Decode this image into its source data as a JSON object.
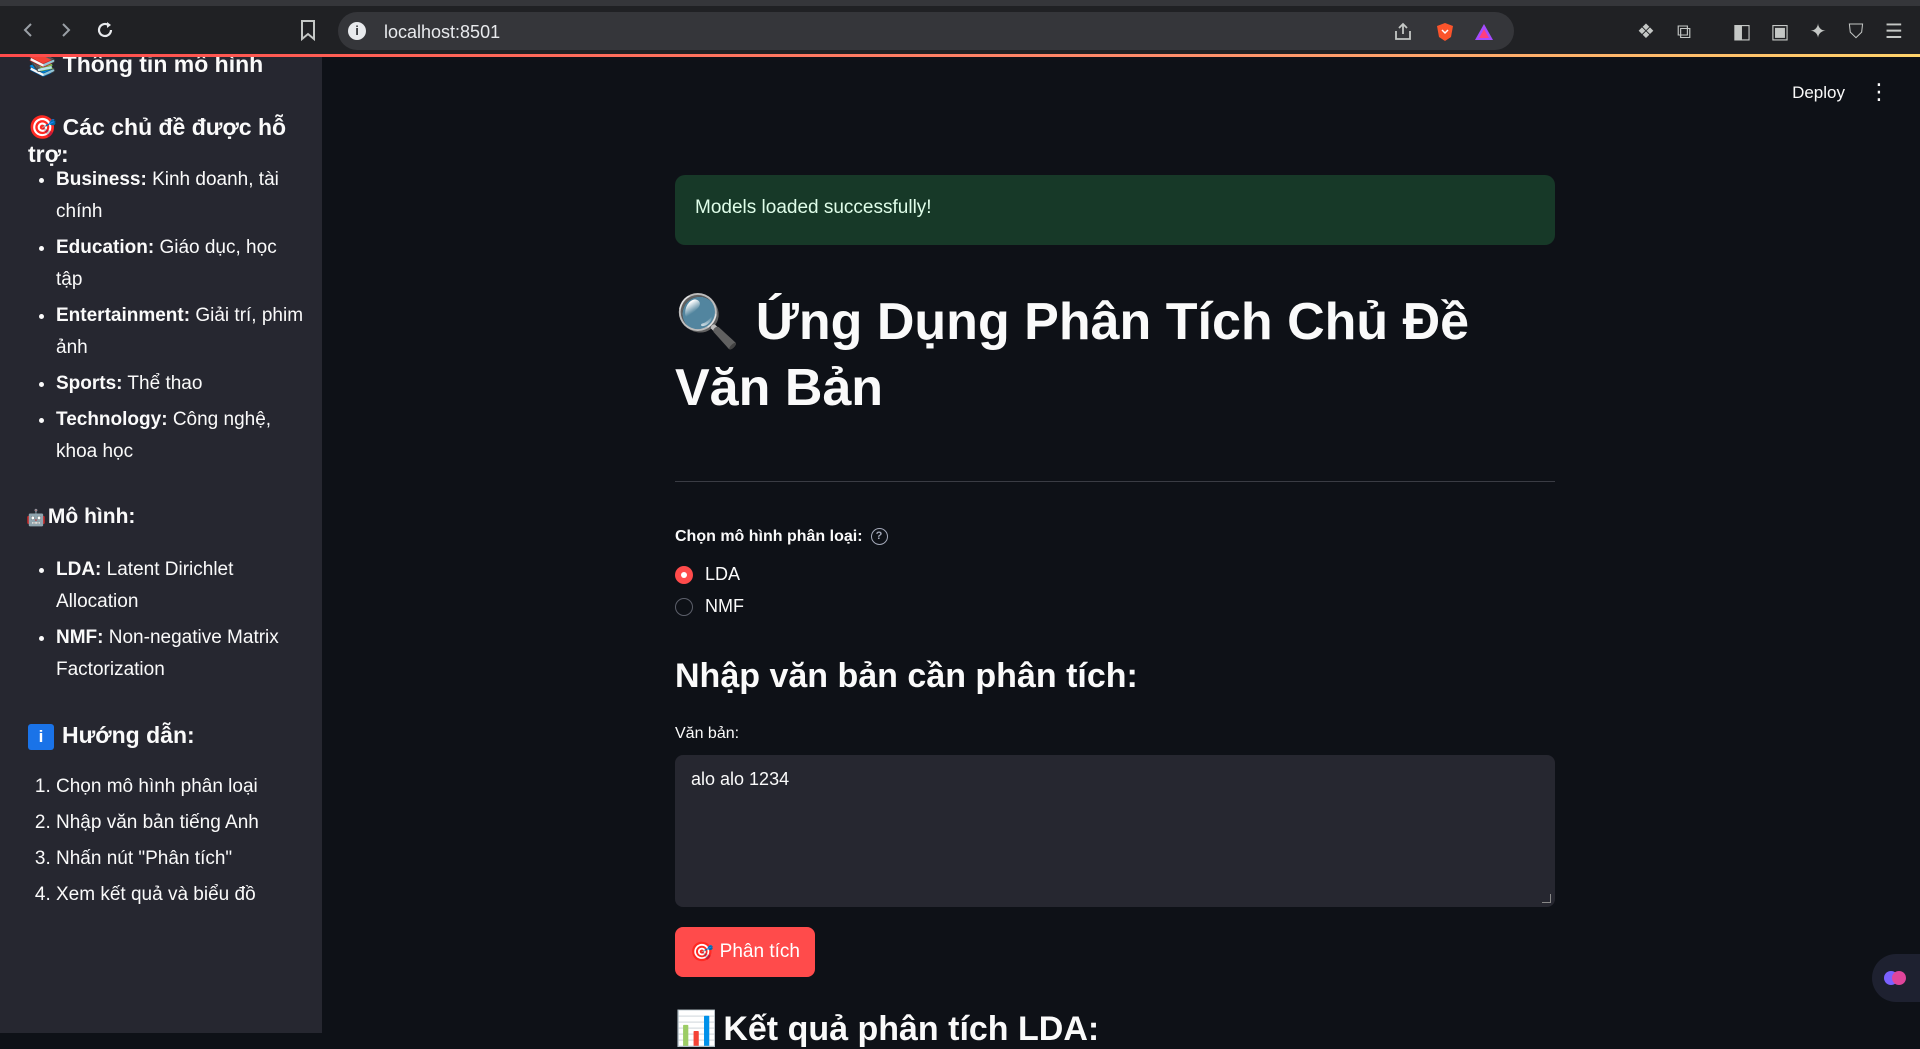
{
  "browser": {
    "url": "localhost:8501",
    "back_icon": "chevron-left-icon",
    "forward_icon": "chevron-right-icon",
    "reload_icon": "reload-icon"
  },
  "sidebar": {
    "model_info_heading": "Thông tin mô hình",
    "topics_heading": "Các chủ đề được hỗ trợ:",
    "topics": [
      {
        "name": "Business:",
        "desc": " Kinh doanh, tài chính"
      },
      {
        "name": "Education:",
        "desc": " Giáo dục, học tập"
      },
      {
        "name": "Entertainment:",
        "desc": " Giải trí, phim ảnh"
      },
      {
        "name": "Sports:",
        "desc": " Thể thao"
      },
      {
        "name": "Technology:",
        "desc": " Công nghệ, khoa học"
      }
    ],
    "models_heading": "Mô hình:",
    "models": [
      {
        "name": "LDA:",
        "desc": " Latent Dirichlet Allocation"
      },
      {
        "name": "NMF:",
        "desc": " Non-negative Matrix Factorization"
      }
    ],
    "guide_heading": "Hướng dẫn:",
    "guide_steps": [
      "Chọn mô hình phân loại",
      "Nhập văn bản tiếng Anh",
      "Nhấn nút \"Phân tích\"",
      "Xem kết quả và biểu đồ"
    ]
  },
  "header": {
    "deploy_label": "Deploy",
    "menu_icon": "kebab-menu-icon"
  },
  "main": {
    "success_message": "Models loaded successfully!",
    "title": "Ứng Dụng Phân Tích Chủ Đề Văn Bản",
    "model_select_label": "Chọn mô hình phân loại:",
    "model_options": [
      "LDA",
      "NMF"
    ],
    "model_selected": "LDA",
    "input_heading": "Nhập văn bản cần phân tích:",
    "textarea_label": "Văn bản:",
    "textarea_value": "alo alo 1234",
    "analyze_button": "Phân tích",
    "result_heading": "Kết quả phân tích LDA:"
  }
}
